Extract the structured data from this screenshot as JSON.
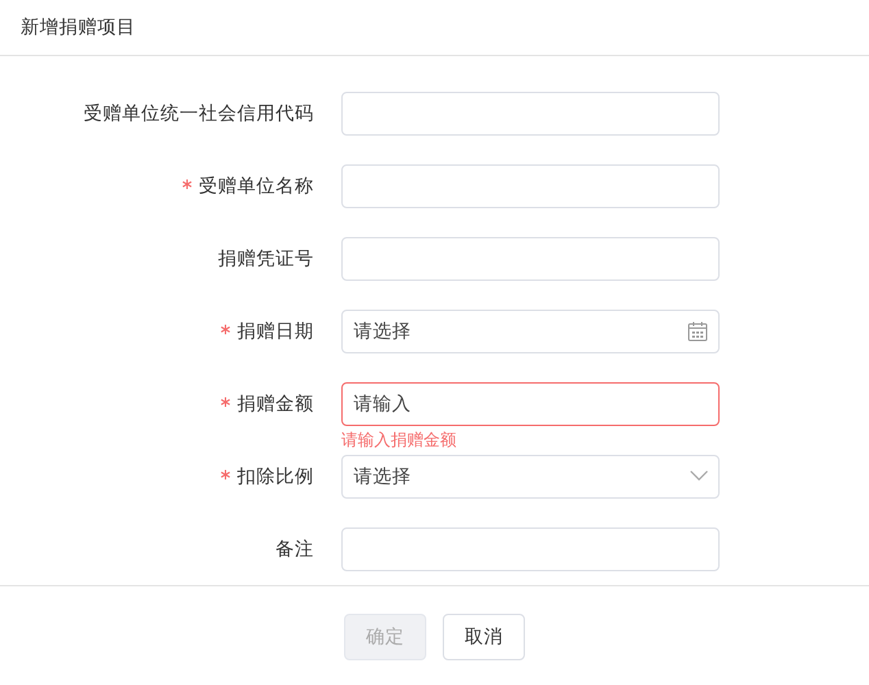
{
  "dialog": {
    "title": "新增捐赠项目"
  },
  "fields": [
    {
      "label": "受赠单位统一社会信用代码",
      "required": false,
      "kind": "text"
    },
    {
      "label": "受赠单位名称",
      "required": true,
      "kind": "text"
    },
    {
      "label": "捐赠凭证号",
      "required": false,
      "kind": "text"
    },
    {
      "label": "捐赠日期",
      "required": true,
      "kind": "date",
      "placeholder": "请选择"
    },
    {
      "label": "捐赠金额",
      "required": true,
      "kind": "text",
      "placeholder": "请输入",
      "error": "请输入捐赠金额"
    },
    {
      "label": "扣除比例",
      "required": true,
      "kind": "select",
      "placeholder": "请选择"
    },
    {
      "label": "备注",
      "required": false,
      "kind": "text"
    }
  ],
  "buttons": [
    {
      "label": "确定",
      "disabled": true
    },
    {
      "label": "取消",
      "disabled": false
    }
  ]
}
